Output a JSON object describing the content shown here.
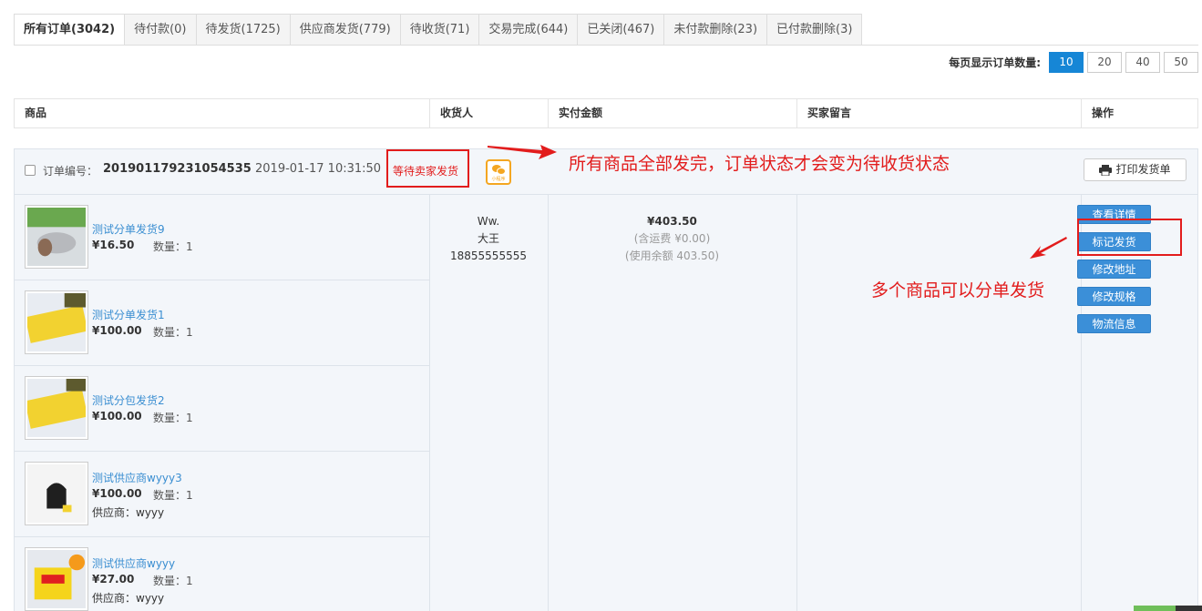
{
  "tabs": [
    {
      "label": "所有订单(3042)",
      "active": true
    },
    {
      "label": "待付款(0)"
    },
    {
      "label": "待发货(1725)"
    },
    {
      "label": "供应商发货(779)"
    },
    {
      "label": "待收货(71)"
    },
    {
      "label": "交易完成(644)"
    },
    {
      "label": "已关闭(467)"
    },
    {
      "label": "未付款删除(23)"
    },
    {
      "label": "已付款删除(3)"
    }
  ],
  "page_size": {
    "label": "每页显示订单数量:",
    "options": [
      "10",
      "20",
      "40",
      "50"
    ],
    "selected": "10"
  },
  "columns": [
    "商品",
    "收货人",
    "实付金额",
    "买家留言",
    "操作"
  ],
  "order": {
    "no_label": "订单编号：",
    "no": "201901179231054535",
    "time": "2019-01-17 10:31:50",
    "status": "等待卖家发货",
    "mini_program_icon": "mini-program-icon",
    "mini_program_text": "小程序",
    "print_label": "打印发货单",
    "items": [
      {
        "name": "测试分单发货9",
        "price": "¥16.50",
        "qty": "数量：1",
        "supplier": ""
      },
      {
        "name": "测试分单发货1",
        "price": "¥100.00",
        "qty": "数量：1",
        "supplier": ""
      },
      {
        "name": "测试分包发货2",
        "price": "¥100.00",
        "qty": "数量：1",
        "supplier": ""
      },
      {
        "name": "测试供应商wyyy3",
        "price": "¥100.00",
        "qty": "数量：1",
        "supplier": "供应商：wyyy"
      },
      {
        "name": "测试供应商wyyy",
        "price": "¥27.00",
        "qty": "数量：1",
        "supplier": "供应商：wyyy"
      }
    ],
    "receiver": {
      "name": "Ww.",
      "name2": "大王",
      "phone": "18855555555"
    },
    "amount": {
      "total": "¥403.50",
      "shipping": "(含运费 ¥0.00)",
      "balance": "(使用余额 403.50)"
    },
    "actions": [
      "查看详情",
      "标记发货",
      "修改地址",
      "修改规格",
      "物流信息"
    ]
  },
  "annotations": {
    "top": "所有商品全部发完，订单状态才会变为待收货状态",
    "side": "多个商品可以分单发货"
  },
  "colors": {
    "accent": "#1686d6",
    "annotation": "#e21c1c",
    "link": "#3a8ed1"
  }
}
